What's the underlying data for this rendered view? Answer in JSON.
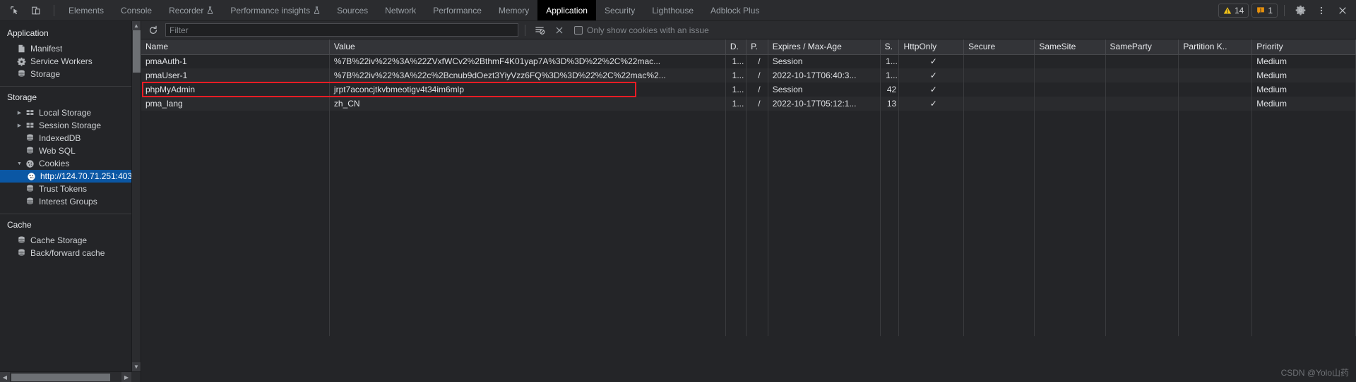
{
  "toolbar": {
    "inspect_icon": "inspect-cursor-icon",
    "device_icon": "device-toggle-icon",
    "tabs": [
      {
        "label": "Elements",
        "active": false,
        "experimental": false
      },
      {
        "label": "Console",
        "active": false,
        "experimental": false
      },
      {
        "label": "Recorder",
        "active": false,
        "experimental": true
      },
      {
        "label": "Performance insights",
        "active": false,
        "experimental": true
      },
      {
        "label": "Sources",
        "active": false,
        "experimental": false
      },
      {
        "label": "Network",
        "active": false,
        "experimental": false
      },
      {
        "label": "Performance",
        "active": false,
        "experimental": false
      },
      {
        "label": "Memory",
        "active": false,
        "experimental": false
      },
      {
        "label": "Application",
        "active": true,
        "experimental": false
      },
      {
        "label": "Security",
        "active": false,
        "experimental": false
      },
      {
        "label": "Lighthouse",
        "active": false,
        "experimental": false
      },
      {
        "label": "Adblock Plus",
        "active": false,
        "experimental": false
      }
    ],
    "warning_count": "14",
    "issue_count": "1",
    "warning_color": "#f5c518",
    "issue_color": "#e8910c",
    "settings_icon": "gear-icon",
    "more_icon": "kebab-menu-icon",
    "close_icon": "close-icon"
  },
  "sidebar": {
    "section_application": "Application",
    "application_items": [
      {
        "label": "Manifest",
        "icon": "manifest-document-icon"
      },
      {
        "label": "Service Workers",
        "icon": "gear-icon"
      },
      {
        "label": "Storage",
        "icon": "database-icon"
      }
    ],
    "section_storage": "Storage",
    "storage_items": [
      {
        "label": "Local Storage",
        "icon": "table-grid-icon",
        "arrow": "collapsed"
      },
      {
        "label": "Session Storage",
        "icon": "table-grid-icon",
        "arrow": "collapsed"
      },
      {
        "label": "IndexedDB",
        "icon": "database-icon",
        "arrow": "none"
      },
      {
        "label": "Web SQL",
        "icon": "database-icon",
        "arrow": "none"
      },
      {
        "label": "Cookies",
        "icon": "cookie-icon",
        "arrow": "expanded"
      }
    ],
    "cookie_origin": {
      "label": "http://124.70.71.251:403",
      "icon": "cookie-icon",
      "selected": true
    },
    "storage_items_tail": [
      {
        "label": "Trust Tokens",
        "icon": "database-icon",
        "arrow": "none"
      },
      {
        "label": "Interest Groups",
        "icon": "database-icon",
        "arrow": "none"
      }
    ],
    "section_cache": "Cache",
    "cache_items": [
      {
        "label": "Cache Storage",
        "icon": "database-icon"
      },
      {
        "label": "Back/forward cache",
        "icon": "database-icon"
      }
    ]
  },
  "filterbar": {
    "refresh_icon": "refresh-icon",
    "filter_placeholder": "Filter",
    "filter_value": "",
    "clear_filtered_icon": "clear-filtered-icon",
    "clear_all_icon": "close-x-icon",
    "issue_checkbox_label": "Only show cookies with an issue",
    "issue_checkbox_checked": false
  },
  "table": {
    "columns": [
      "Name",
      "Value",
      "D.",
      "P.",
      "Expires / Max-Age",
      "S.",
      "HttpOnly",
      "Secure",
      "SameSite",
      "SameParty",
      "Partition K..",
      "Priority"
    ],
    "rows": [
      {
        "name": "pmaAuth-1",
        "value": "%7B%22iv%22%3A%22ZVxfWCv2%2BthmF4K01yap7A%3D%3D%22%2C%22mac...",
        "domain": "1...",
        "path": "/",
        "expires": "Session",
        "size": "1...",
        "httponly": "✓",
        "secure": "",
        "samesite": "",
        "sameparty": "",
        "partitionkey": "",
        "priority": "Medium",
        "highlighted": false
      },
      {
        "name": "pmaUser-1",
        "value": "%7B%22iv%22%3A%22c%2Bcnub9dOezt3YiyVzz6FQ%3D%3D%22%2C%22mac%2...",
        "domain": "1...",
        "path": "/",
        "expires": "2022-10-17T06:40:3...",
        "size": "1...",
        "httponly": "✓",
        "secure": "",
        "samesite": "",
        "sameparty": "",
        "partitionkey": "",
        "priority": "Medium",
        "highlighted": false
      },
      {
        "name": "phpMyAdmin",
        "value": "jrpt7aconcjtkvbmeotigv4t34im6mlp",
        "domain": "1...",
        "path": "/",
        "expires": "Session",
        "size": "42",
        "httponly": "✓",
        "secure": "",
        "samesite": "",
        "sameparty": "",
        "partitionkey": "",
        "priority": "Medium",
        "highlighted": true
      },
      {
        "name": "pma_lang",
        "value": "zh_CN",
        "domain": "1...",
        "path": "/",
        "expires": "2022-10-17T05:12:1...",
        "size": "13",
        "httponly": "✓",
        "secure": "",
        "samesite": "",
        "sameparty": "",
        "partitionkey": "",
        "priority": "Medium",
        "highlighted": false
      }
    ]
  },
  "watermark": "CSDN @Yolo山药"
}
